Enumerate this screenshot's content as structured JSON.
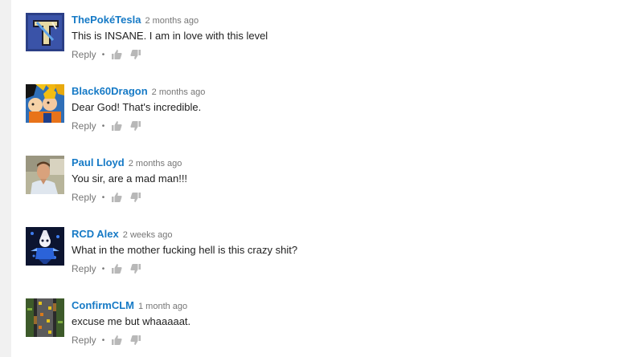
{
  "comments": [
    {
      "author": "ThePokéTesla",
      "time": "2 months ago",
      "text": "This is INSANE. I am in love with this level",
      "reply": "Reply",
      "avatar": "tesla-logo-icon"
    },
    {
      "author": "Black60Dragon",
      "time": "2 months ago",
      "text": "Dear God! That's incredible.",
      "reply": "Reply",
      "avatar": "anime-characters-avatar"
    },
    {
      "author": "Paul Lloyd",
      "time": "2 months ago",
      "text": "You sir, are a mad man!!!",
      "reply": "Reply",
      "avatar": "person-photo-avatar"
    },
    {
      "author": "RCD Alex",
      "time": "2 weeks ago",
      "text": "What in the mother fucking hell is this crazy shit?",
      "reply": "Reply",
      "avatar": "skeleton-character-avatar"
    },
    {
      "author": "ConfirmCLM",
      "time": "1 month ago",
      "text": "excuse me but whaaaaat.",
      "reply": "Reply",
      "avatar": "game-level-avatar"
    }
  ],
  "colors": {
    "author": "#167ac6",
    "meta": "#767676",
    "text": "#222222",
    "icon": "#b8b8b8",
    "sidebar": "#f1f1f1"
  },
  "icons": {
    "like": "thumb-up-icon",
    "dislike": "thumb-down-icon"
  }
}
